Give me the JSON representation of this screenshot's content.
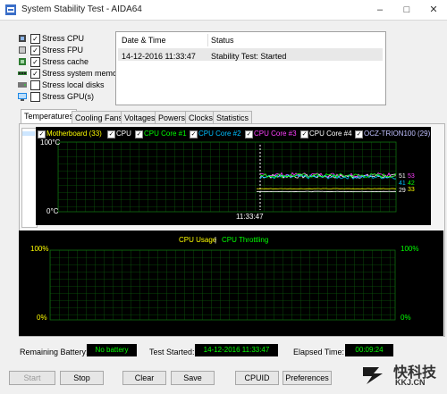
{
  "window": {
    "title": "System Stability Test - AIDA64"
  },
  "stress_options": [
    {
      "label": "Stress CPU",
      "checked": true,
      "icon": "cpu-icon"
    },
    {
      "label": "Stress FPU",
      "checked": true,
      "icon": "fpu-icon"
    },
    {
      "label": "Stress cache",
      "checked": true,
      "icon": "cache-icon"
    },
    {
      "label": "Stress system memory",
      "checked": true,
      "icon": "memory-icon"
    },
    {
      "label": "Stress local disks",
      "checked": false,
      "icon": "disk-icon"
    },
    {
      "label": "Stress GPU(s)",
      "checked": false,
      "icon": "gpu-icon"
    }
  ],
  "log": {
    "headers": {
      "date": "Date & Time",
      "status": "Status"
    },
    "rows": [
      {
        "date": "14-12-2016 11:33:47",
        "status": "Stability Test: Started"
      }
    ]
  },
  "tabs": [
    {
      "label": "Temperatures",
      "active": true
    },
    {
      "label": "Cooling Fans"
    },
    {
      "label": "Voltages"
    },
    {
      "label": "Powers"
    },
    {
      "label": "Clocks"
    },
    {
      "label": "Statistics"
    }
  ],
  "temp_chart": {
    "legend": [
      {
        "label": "Motherboard (33)",
        "color": "#ffff00",
        "checked": true
      },
      {
        "label": "CPU",
        "color": "#ffffff",
        "checked": true
      },
      {
        "label": "CPU Core #1",
        "color": "#00ff00",
        "checked": true
      },
      {
        "label": "CPU Core #2",
        "color": "#00c0ff",
        "checked": true
      },
      {
        "label": "CPU Core #3",
        "color": "#ff40ff",
        "checked": true
      },
      {
        "label": "CPU Core #4",
        "color": "#ffffff",
        "checked": true
      },
      {
        "label": "OCZ-TRION100 (29)",
        "color": "#c0c0ff",
        "checked": true
      }
    ],
    "y_top": "100°C",
    "y_bottom": "0°C",
    "time_label": "11:33:47",
    "readings": [
      {
        "value": "51",
        "color": "#ffffff"
      },
      {
        "value": "53",
        "color": "#ff40ff"
      },
      {
        "value": "41",
        "color": "#00c0ff"
      },
      {
        "value": "42",
        "color": "#00ff00"
      },
      {
        "value": "29",
        "color": "#ffffff"
      },
      {
        "value": "33",
        "color": "#ffff00"
      }
    ]
  },
  "cpu_chart": {
    "title_usage": "CPU Usage",
    "separator": "|",
    "title_throttle": "CPU Throttling",
    "left_top": "100%",
    "left_bottom": "0%",
    "right_top": "100%",
    "right_bottom": "0%",
    "usage_color": "#ffff00",
    "throttle_color": "#00ff00"
  },
  "status": {
    "battery_label": "Remaining Battery:",
    "battery_value": "No battery",
    "started_label": "Test Started:",
    "started_value": "14-12-2016 11:33:47",
    "elapsed_label": "Elapsed Time:",
    "elapsed_value": "00:09:24"
  },
  "buttons": {
    "start": "Start",
    "stop": "Stop",
    "clear": "Clear",
    "save": "Save",
    "cpuid": "CPUID",
    "preferences": "Preferences"
  },
  "watermark": {
    "brand": "快科技",
    "url": "KKJ.CN"
  }
}
